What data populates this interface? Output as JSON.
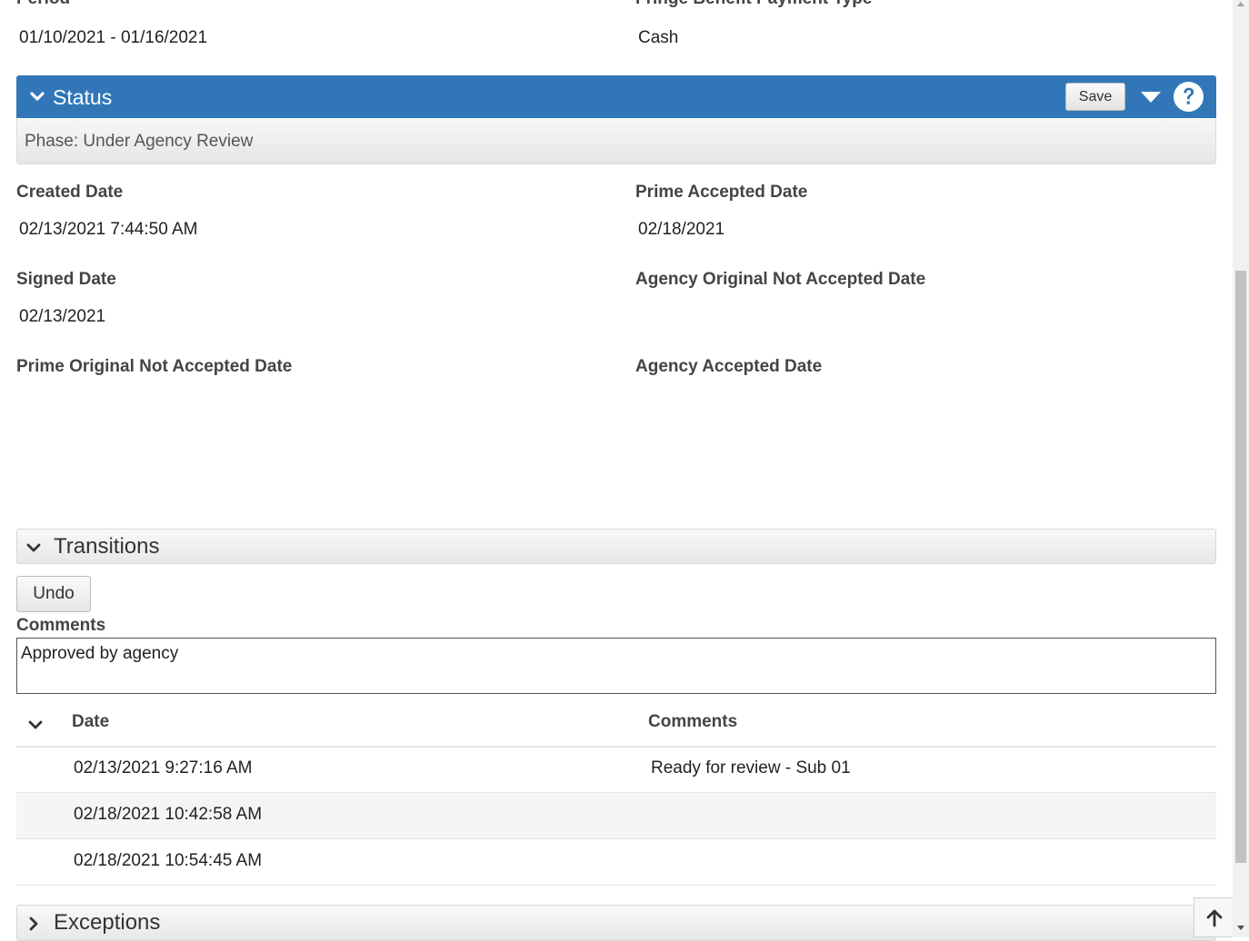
{
  "top_fields": {
    "period_label": "Period",
    "period_value": "01/10/2021 - 01/16/2021",
    "fringe_label": "Fringe Benefit Payment Type",
    "fringe_value": "Cash"
  },
  "status_panel": {
    "title": "Status",
    "save_label": "Save",
    "phase_text": "Phase: Under Agency Review"
  },
  "status_fields": {
    "created_date_label": "Created Date",
    "created_date_value": "02/13/2021 7:44:50 AM",
    "prime_accepted_label": "Prime Accepted Date",
    "prime_accepted_value": "02/18/2021",
    "signed_date_label": "Signed Date",
    "signed_date_value": "02/13/2021",
    "agency_orig_not_accepted_label": "Agency Original Not Accepted Date",
    "prime_orig_not_accepted_label": "Prime Original Not Accepted Date",
    "agency_accepted_label": "Agency Accepted Date"
  },
  "transitions": {
    "title": "Transitions",
    "undo_label": "Undo",
    "comments_label": "Comments",
    "comments_value": "Approved by agency",
    "columns": [
      "Date",
      "Comments"
    ],
    "rows": [
      {
        "date": "02/13/2021 9:27:16 AM",
        "comment": "Ready for review - Sub 01"
      },
      {
        "date": "02/18/2021 10:42:58 AM",
        "comment": ""
      },
      {
        "date": "02/18/2021 10:54:45 AM",
        "comment": ""
      }
    ]
  },
  "exceptions": {
    "title": "Exceptions"
  },
  "icons": {
    "status_chevron": "chevron-down-icon",
    "menu": "caret-down-icon",
    "help": "question-circle-icon",
    "transitions_chevron": "chevron-down-icon",
    "grid_chevron": "chevron-down-icon",
    "exceptions_chevron": "chevron-right-icon",
    "scroll_top": "arrow-up-icon"
  },
  "colors": {
    "status_header": "#3177b8"
  }
}
